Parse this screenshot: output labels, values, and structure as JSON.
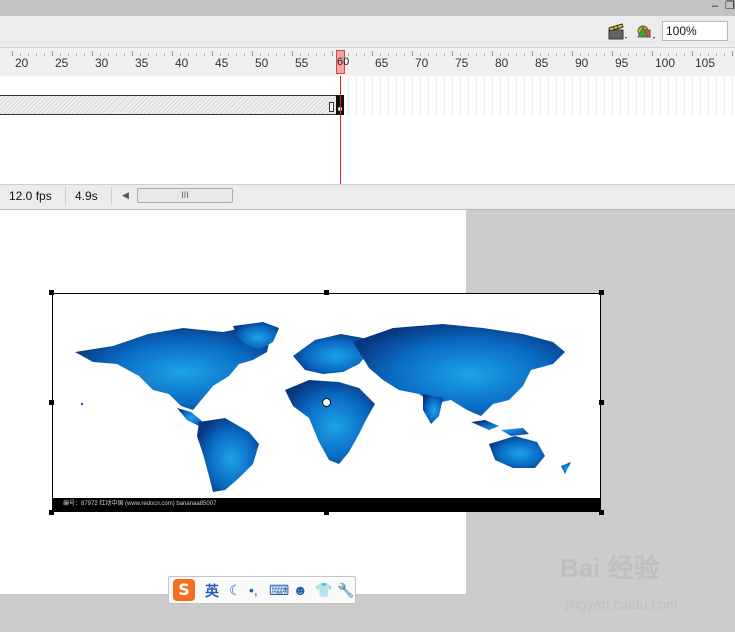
{
  "titlebar": {
    "minimize_glyph": "–",
    "restore_glyph": "❐"
  },
  "toolbar": {
    "edit_scene_icon": "clapper-icon",
    "edit_symbols_icon": "symbols-icon",
    "zoom_value": "100%"
  },
  "timeline": {
    "ruler_labels": [
      "20",
      "25",
      "30",
      "35",
      "40",
      "45",
      "50",
      "55",
      "60",
      "65",
      "70",
      "75",
      "80",
      "85",
      "90",
      "95",
      "100",
      "105"
    ],
    "current_frame": "60"
  },
  "status": {
    "fps": "12.0 fps",
    "elapsed": "4.9s",
    "scroll_thumb": "III"
  },
  "stage": {
    "map_caption": "编号：87972  红动中国 (www.redocn.com)  bananaa85007"
  },
  "ime": {
    "logo": "S",
    "mode": "英"
  },
  "watermark": {
    "brand": "Bai 经验",
    "url": "jingyan.baidu.com"
  },
  "colors": {
    "playhead": "#dd2222",
    "map_blue": "#0a5cb5",
    "pasteboard": "#cccccc"
  }
}
